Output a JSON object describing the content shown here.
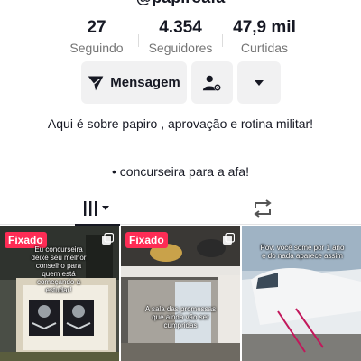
{
  "profile": {
    "username": "@papiroafa"
  },
  "stats": [
    {
      "value": "27",
      "label": "Seguindo"
    },
    {
      "value": "4.354",
      "label": "Seguidores"
    },
    {
      "value": "47,9 mil",
      "label": "Curtidas"
    }
  ],
  "actions": {
    "message_label": "Mensagem",
    "message_icon": "send-icon",
    "friends_icon": "user-settings-icon",
    "more_icon": "caret-down-icon"
  },
  "bio": {
    "line1": "Aqui é sobre papiro , aprovação e rotina militar!",
    "line2": "• concurseira para a afa!"
  },
  "tabs": {
    "videos_icon": "grid-icon",
    "reposts_icon": "repost-icon"
  },
  "videos": [
    {
      "pinned_label": "Fixado",
      "caption": "Eu concurseira deixe seu melhor conselho para quem está começando a estudar!"
    },
    {
      "pinned_label": "Fixado",
      "caption": "A sala das promessas que ainda vão ser cumpridas"
    },
    {
      "pinned_label": "",
      "caption": "Pov: você some por 1 ano e do nada aparece assim"
    }
  ],
  "colors": {
    "accent": "#fe2c55",
    "text": "#161823",
    "muted": "#757575",
    "button_bg": "#f1f1f2"
  }
}
